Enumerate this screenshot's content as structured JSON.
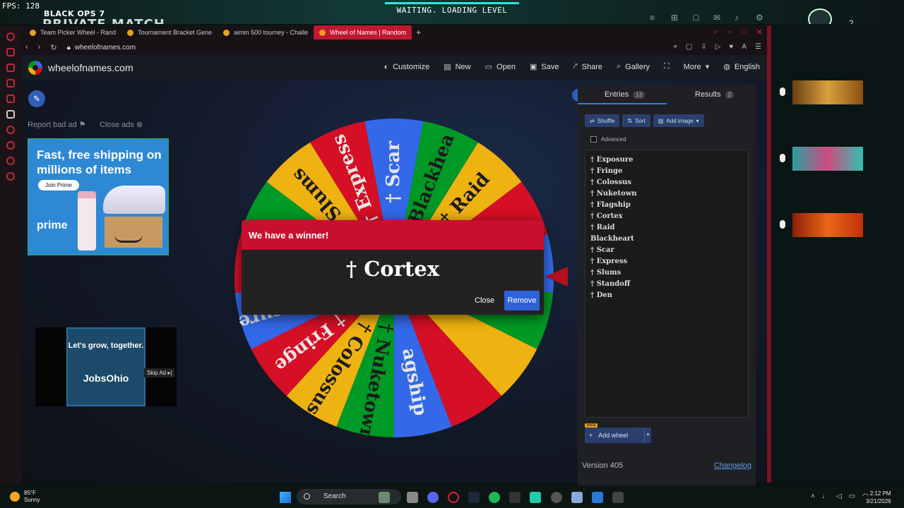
{
  "overlay": {
    "fps": "FPS: 128",
    "game_title": "BLACK OPS 7",
    "game_mode": "PRIVATE MATCH",
    "loading": "WAITING. LOADING LEVEL",
    "rank": "2"
  },
  "tabs": [
    {
      "label": "Team Picker Wheel - Rand",
      "active": false
    },
    {
      "label": "Tournament Bracket Gene",
      "active": false
    },
    {
      "label": "aimin 500 tourney - Challe",
      "active": false
    },
    {
      "label": "Wheel of Names | Random",
      "active": true
    }
  ],
  "address": {
    "url": "wheelofnames.com"
  },
  "site": {
    "logo": "wheelofnames.com",
    "nav": [
      {
        "label": "Customize",
        "icon": "palette-icon"
      },
      {
        "label": "New",
        "icon": "file-icon"
      },
      {
        "label": "Open",
        "icon": "folder-icon"
      },
      {
        "label": "Save",
        "icon": "save-icon"
      },
      {
        "label": "Share",
        "icon": "share-icon"
      },
      {
        "label": "Gallery",
        "icon": "search-icon"
      },
      {
        "label": "",
        "icon": "fullscreen-icon"
      },
      {
        "label": "More",
        "icon": "chevron-down-icon"
      },
      {
        "label": "English",
        "icon": "globe-icon"
      }
    ],
    "report_ad": "Report bad ad",
    "close_ads": "Close ads"
  },
  "ads": {
    "ad1_headline": "Fast, free shipping on millions of items",
    "ad1_button": "Join Prime",
    "ad1_brand": "prime",
    "ad2_text": "Let's grow, together.",
    "ad2_brand": "JobsOhio",
    "ad2_skip": "Skip Ad"
  },
  "wheel": {
    "colors": {
      "blue": "#3369e8",
      "green": "#009925",
      "yellow": "#eeb211",
      "red": "#d50f25"
    },
    "segments": [
      {
        "label": "† Scar",
        "color": "blue"
      },
      {
        "label": "Blackhea",
        "color": "green"
      },
      {
        "label": "† Raid",
        "color": "yellow"
      },
      {
        "label": "",
        "color": "red"
      },
      {
        "label": "",
        "color": "blue"
      },
      {
        "label": "",
        "color": "green"
      },
      {
        "label": "",
        "color": "yellow"
      },
      {
        "label": "",
        "color": "red"
      },
      {
        "label": "agship",
        "color": "blue"
      },
      {
        "label": "† Nuketown",
        "color": "green"
      },
      {
        "label": "† Colossus",
        "color": "yellow"
      },
      {
        "label": "† Fringe",
        "color": "red"
      },
      {
        "label": "† Exposure",
        "color": "blue"
      },
      {
        "label": "† Den",
        "color": "red"
      },
      {
        "label": "",
        "color": "green"
      },
      {
        "label": "† Slums",
        "color": "yellow"
      },
      {
        "label": "† Express",
        "color": "red"
      }
    ]
  },
  "dialog": {
    "title": "We have a winner!",
    "winner": "† Cortex",
    "close": "Close",
    "remove": "Remove"
  },
  "panel": {
    "tab_entries": "Entries",
    "entries_count": "13",
    "tab_results": "Results",
    "results_count": "2",
    "shuffle": "Shuffle",
    "sort": "Sort",
    "add_image": "Add image",
    "advanced": "Advanced",
    "entries": [
      "† Exposure",
      "† Fringe",
      "† Colossus",
      "† Nuketown",
      "† Flagship",
      "† Cortex",
      "† Raid",
      "Blackheart",
      "† Scar",
      "† Express",
      "† Slums",
      "† Standoff",
      "† Den"
    ],
    "beta": "Beta",
    "add_wheel": "Add wheel",
    "version": "Version 405",
    "changelog": "Changelog"
  },
  "taskbar": {
    "temp": "85°F",
    "weather": "Sunny",
    "search": "Search",
    "time": "2:12 PM",
    "date": "3/21/2026"
  }
}
